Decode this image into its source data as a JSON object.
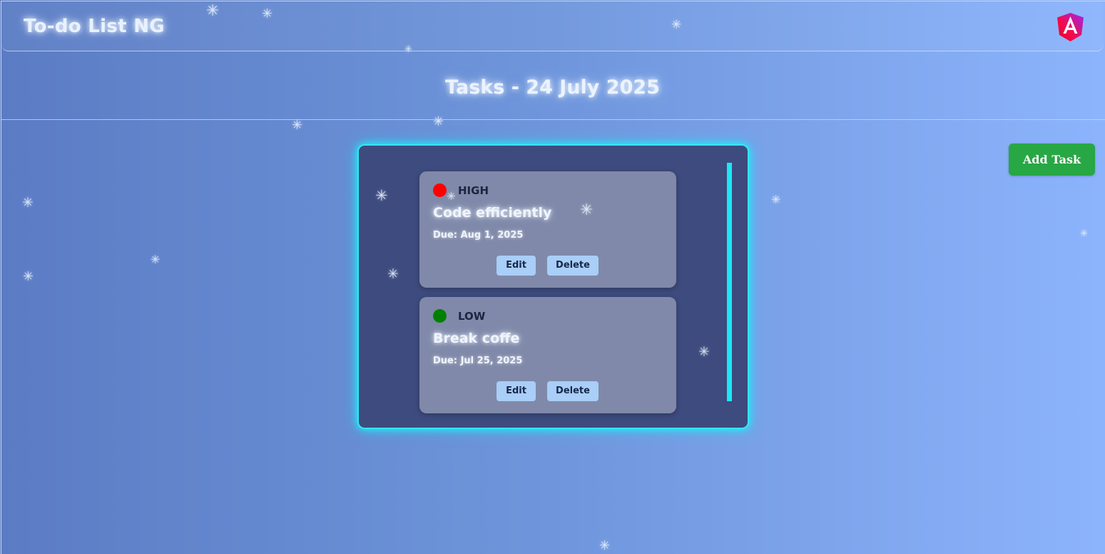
{
  "header": {
    "app_title": "To-do List NG",
    "logo_icon": "angular-logo-icon"
  },
  "page": {
    "heading": "Tasks - 24 July 2025"
  },
  "toolbar": {
    "add_task_label": "Add Task"
  },
  "tasks": [
    {
      "priority": "HIGH",
      "priority_color": "#ff0000",
      "title": "Code efficiently",
      "due": "Due: Aug 1, 2025",
      "edit_label": "Edit",
      "delete_label": "Delete"
    },
    {
      "priority": "LOW",
      "priority_color": "#008000",
      "title": "Break coffe",
      "due": "Due: Jul 25, 2025",
      "edit_label": "Edit",
      "delete_label": "Delete"
    }
  ],
  "colors": {
    "panel_glow": "#1ff3ff",
    "add_button": "#28a745",
    "action_button": "#a9cef7"
  },
  "decoration": {
    "snowflake_icon": "snowflake-icon"
  }
}
